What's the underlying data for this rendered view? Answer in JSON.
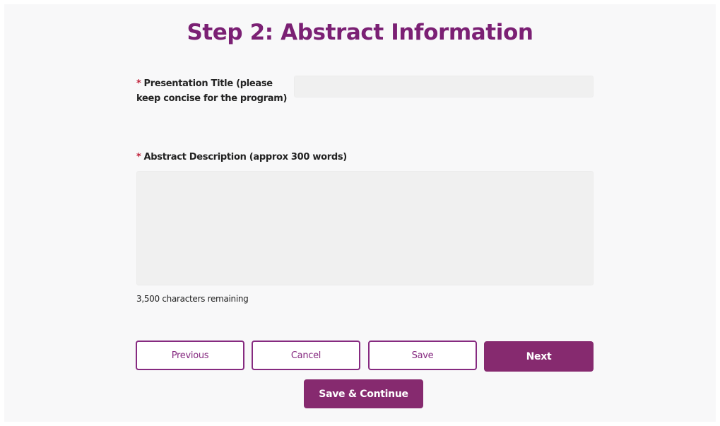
{
  "page": {
    "title": "Step 2: Abstract Information"
  },
  "form": {
    "required_marker": "*",
    "presentation_title": {
      "label": "Presentation Title (please keep concise for the program)",
      "value": "",
      "placeholder": ""
    },
    "abstract_description": {
      "label": "Abstract Description (approx 300 words)",
      "value": "",
      "placeholder": "",
      "characters_remaining": "3,500 characters remaining"
    }
  },
  "buttons": {
    "previous": "Previous",
    "cancel": "Cancel",
    "save": "Save",
    "next": "Next",
    "save_continue": "Save & Continue"
  },
  "colors": {
    "accent": "#862a6f",
    "title": "#7b2074",
    "required": "#c0213a",
    "background": "#f8f8f9",
    "input_background": "#f0f0f0"
  }
}
